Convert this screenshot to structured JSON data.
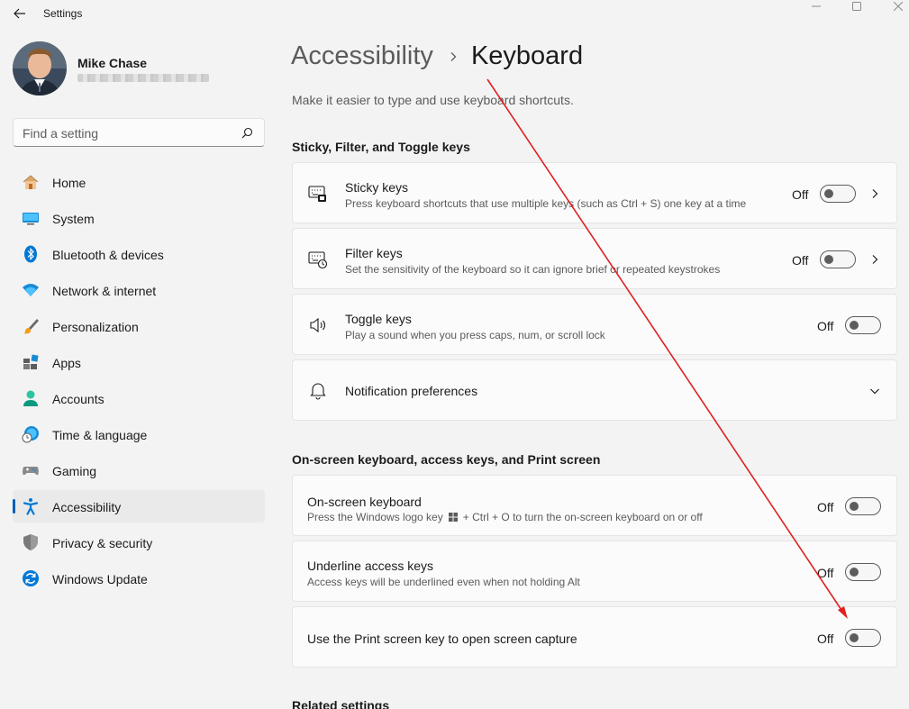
{
  "window": {
    "title": "Settings"
  },
  "profile": {
    "name": "Mike Chase"
  },
  "search": {
    "placeholder": "Find a setting"
  },
  "sidebar": {
    "items": [
      {
        "label": "Home",
        "icon": "home-icon"
      },
      {
        "label": "System",
        "icon": "system-icon"
      },
      {
        "label": "Bluetooth & devices",
        "icon": "bluetooth-icon"
      },
      {
        "label": "Network & internet",
        "icon": "wifi-icon"
      },
      {
        "label": "Personalization",
        "icon": "brush-icon"
      },
      {
        "label": "Apps",
        "icon": "apps-icon"
      },
      {
        "label": "Accounts",
        "icon": "accounts-icon"
      },
      {
        "label": "Time & language",
        "icon": "clock-globe-icon"
      },
      {
        "label": "Gaming",
        "icon": "gamepad-icon"
      },
      {
        "label": "Accessibility",
        "icon": "accessibility-icon",
        "selected": true
      },
      {
        "label": "Privacy & security",
        "icon": "shield-icon"
      },
      {
        "label": "Windows Update",
        "icon": "update-icon"
      }
    ]
  },
  "header": {
    "parent": "Accessibility",
    "current": "Keyboard",
    "subtitle": "Make it easier to type and use keyboard shortcuts."
  },
  "sections": {
    "sticky": {
      "title": "Sticky, Filter, and Toggle keys",
      "sticky_keys": {
        "title": "Sticky keys",
        "desc": "Press keyboard shortcuts that use multiple keys (such as Ctrl + S) one key at a time",
        "state": "Off"
      },
      "filter_keys": {
        "title": "Filter keys",
        "desc": "Set the sensitivity of the keyboard so it can ignore brief or repeated keystrokes",
        "state": "Off"
      },
      "toggle_keys": {
        "title": "Toggle keys",
        "desc": "Play a sound when you press caps, num, or scroll lock",
        "state": "Off"
      },
      "notifications": {
        "title": "Notification preferences"
      }
    },
    "onscreen": {
      "title": "On-screen keyboard, access keys, and Print screen",
      "osk": {
        "title": "On-screen keyboard",
        "desc_before": "Press the Windows logo key",
        "desc_after": "+ Ctrl + O to turn the on-screen keyboard on or off",
        "state": "Off"
      },
      "underline": {
        "title": "Underline access keys",
        "desc": "Access keys will be underlined even when not holding Alt",
        "state": "Off"
      },
      "print_screen": {
        "title": "Use the Print screen key to open screen capture",
        "state": "Off"
      }
    },
    "related": {
      "title": "Related settings"
    }
  },
  "colors": {
    "accent": "#005fb8",
    "annotation_arrow": "#e02020"
  }
}
